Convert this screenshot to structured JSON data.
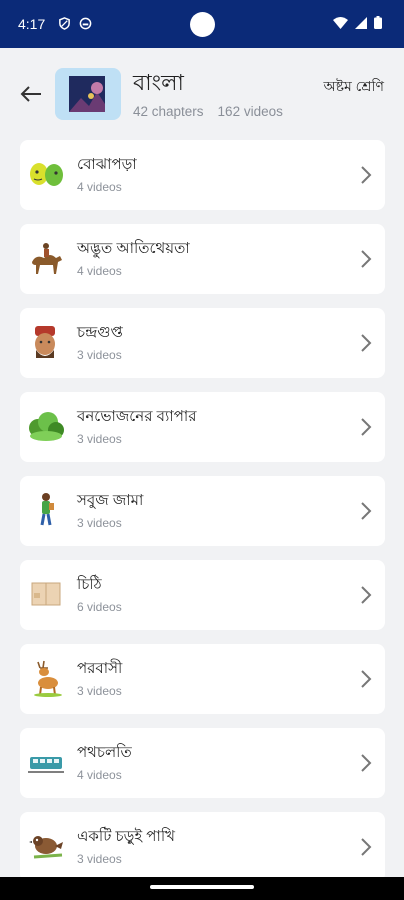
{
  "status_bar": {
    "time": "4:17"
  },
  "header": {
    "title": "বাংলা",
    "chapters": "42 chapters",
    "videos": "162 videos",
    "class_label": "অষ্টম শ্রেণি"
  },
  "chapters": [
    {
      "title": "বোঝাপড়া",
      "count": "4 videos",
      "icon": "two-faces-icon"
    },
    {
      "title": "অদ্ভুত আতিথেয়তা",
      "count": "4 videos",
      "icon": "camel-rider-icon"
    },
    {
      "title": "চন্দ্রগুপ্ত",
      "count": "3 videos",
      "icon": "king-portrait-icon"
    },
    {
      "title": "বনভোজনের ব্যাপার",
      "count": "3 videos",
      "icon": "bush-icon"
    },
    {
      "title": "সবুজ জামা",
      "count": "3 videos",
      "icon": "child-icon"
    },
    {
      "title": "চিঠি",
      "count": "6 videos",
      "icon": "envelope-icon"
    },
    {
      "title": "পরবাসী",
      "count": "3 videos",
      "icon": "deer-icon"
    },
    {
      "title": "পথচলতি",
      "count": "4 videos",
      "icon": "train-icon"
    },
    {
      "title": "একটি চড়ুই পাখি",
      "count": "3 videos",
      "icon": "sparrow-icon"
    }
  ],
  "colors": {
    "status_bar": "#0b2a78",
    "background": "#f1f2f4",
    "card": "#ffffff",
    "secondary_text": "#8a8f98"
  }
}
